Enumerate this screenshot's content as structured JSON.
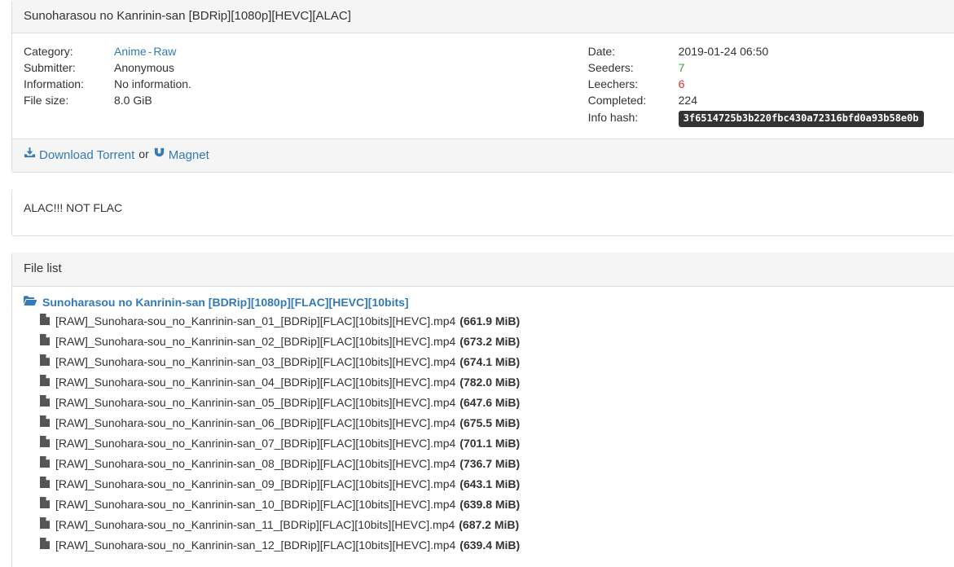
{
  "torrent": {
    "title": "Sunoharasou no Kanrinin-san [BDRip][1080p][HEVC][ALAC]",
    "left_fields": {
      "category_label": "Category:",
      "category_primary": "Anime",
      "category_separator": "-",
      "category_secondary": "Raw",
      "submitter_label": "Submitter:",
      "submitter_value": "Anonymous",
      "information_label": "Information:",
      "information_value": "No information.",
      "filesize_label": "File size:",
      "filesize_value": "8.0 GiB"
    },
    "right_fields": {
      "date_label": "Date:",
      "date_value": "2019-01-24 06:50",
      "seeders_label": "Seeders:",
      "seeders_value": "7",
      "leechers_label": "Leechers:",
      "leechers_value": "6",
      "completed_label": "Completed:",
      "completed_value": "224",
      "infohash_label": "Info hash:",
      "infohash_value": "3f6514725b3b220fbc430a72316bfd0a93b58e0b"
    },
    "download": {
      "torrent_label": "Download Torrent",
      "separator": "or",
      "magnet_label": "Magnet",
      "download_icon": "download-icon",
      "magnet_icon": "magnet-icon"
    }
  },
  "description": {
    "text": "ALAC!!! NOT FLAC"
  },
  "filelist": {
    "heading": "File list",
    "folder_icon": "folder-open-icon",
    "file_icon": "file-icon",
    "folder_name": "Sunoharasou no Kanrinin-san [BDRip][1080p][FLAC][HEVC][10bits]",
    "files": [
      {
        "name": "[RAW]_Sunohara-sou_no_Kanrinin-san_01_[BDRip][FLAC][10bits][HEVC].mp4",
        "size": "(661.9 MiB)"
      },
      {
        "name": "[RAW]_Sunohara-sou_no_Kanrinin-san_02_[BDRip][FLAC][10bits][HEVC].mp4",
        "size": "(673.2 MiB)"
      },
      {
        "name": "[RAW]_Sunohara-sou_no_Kanrinin-san_03_[BDRip][FLAC][10bits][HEVC].mp4",
        "size": "(674.1 MiB)"
      },
      {
        "name": "[RAW]_Sunohara-sou_no_Kanrinin-san_04_[BDRip][FLAC][10bits][HEVC].mp4",
        "size": "(782.0 MiB)"
      },
      {
        "name": "[RAW]_Sunohara-sou_no_Kanrinin-san_05_[BDRip][FLAC][10bits][HEVC].mp4",
        "size": "(647.6 MiB)"
      },
      {
        "name": "[RAW]_Sunohara-sou_no_Kanrinin-san_06_[BDRip][FLAC][10bits][HEVC].mp4",
        "size": "(675.5 MiB)"
      },
      {
        "name": "[RAW]_Sunohara-sou_no_Kanrinin-san_07_[BDRip][FLAC][10bits][HEVC].mp4",
        "size": "(701.1 MiB)"
      },
      {
        "name": "[RAW]_Sunohara-sou_no_Kanrinin-san_08_[BDRip][FLAC][10bits][HEVC].mp4",
        "size": "(736.7 MiB)"
      },
      {
        "name": "[RAW]_Sunohara-sou_no_Kanrinin-san_09_[BDRip][FLAC][10bits][HEVC].mp4",
        "size": "(643.1 MiB)"
      },
      {
        "name": "[RAW]_Sunohara-sou_no_Kanrinin-san_10_[BDRip][FLAC][10bits][HEVC].mp4",
        "size": "(639.8 MiB)"
      },
      {
        "name": "[RAW]_Sunohara-sou_no_Kanrinin-san_11_[BDRip][FLAC][10bits][HEVC].mp4",
        "size": "(687.2 MiB)"
      },
      {
        "name": "[RAW]_Sunohara-sou_no_Kanrinin-san_12_[BDRip][FLAC][10bits][HEVC].mp4",
        "size": "(639.4 MiB)"
      }
    ]
  },
  "colors": {
    "link": "#337ab7",
    "seeders": "#3c9d3c",
    "leechers": "#dd3333",
    "panel_heading_bg": "#f5f5f5",
    "panel_border": "#dddddd",
    "infohash_bg": "#333333"
  }
}
